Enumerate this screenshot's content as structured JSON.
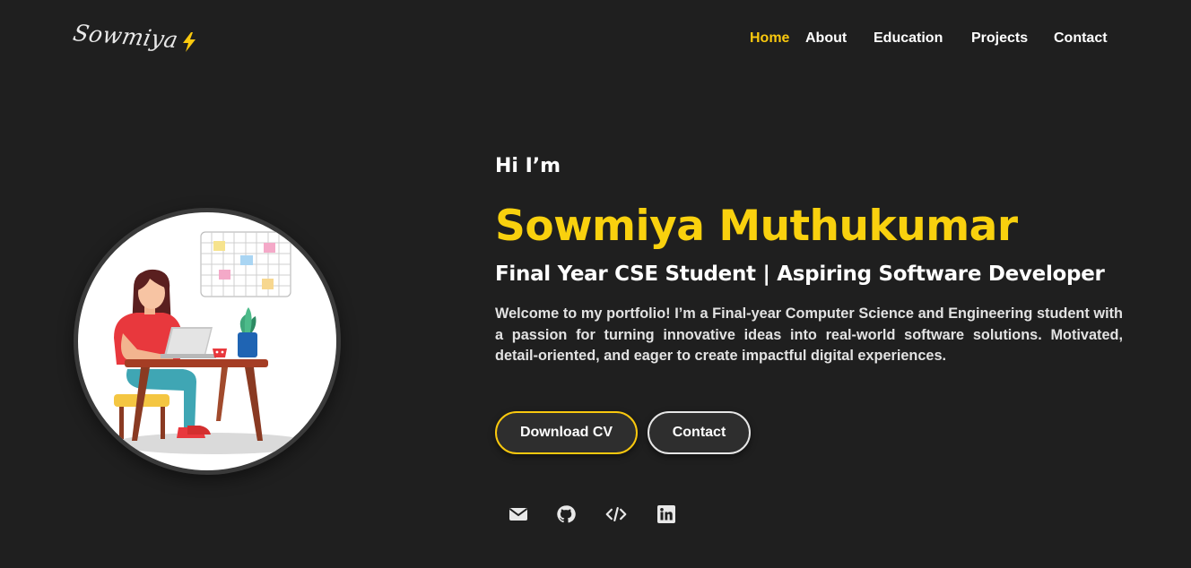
{
  "brand": {
    "logo_text": "Sowmiya",
    "logo_icon": "lightning-bolt-icon"
  },
  "nav": {
    "items": [
      {
        "label": "Home",
        "active": true
      },
      {
        "label": "About",
        "active": false
      },
      {
        "label": "Education",
        "active": false
      },
      {
        "label": "Projects",
        "active": false
      },
      {
        "label": "Contact",
        "active": false
      }
    ]
  },
  "hero": {
    "greeting": "Hi I’m",
    "name": "Sowmiya Muthukumar",
    "role": "Final Year CSE Student | Aspiring Software Developer",
    "intro": "Welcome to my portfolio! I’m a Final-year Computer Science and Engineering student with a passion for turning innovative ideas into real-world software solutions. Motivated, detail-oriented, and eager to create impactful digital experiences.",
    "buttons": {
      "download_cv": "Download CV",
      "contact": "Contact"
    },
    "avatar_icon": "girl-at-laptop-illustration"
  },
  "social": [
    "email-icon",
    "github-icon",
    "code-icon",
    "linkedin-icon"
  ],
  "colors": {
    "background": "#1f1f1f",
    "accent": "#f9c80e",
    "name": "#f9d10e",
    "text": "#ffffff",
    "button_bg": "#2e2e2e"
  }
}
